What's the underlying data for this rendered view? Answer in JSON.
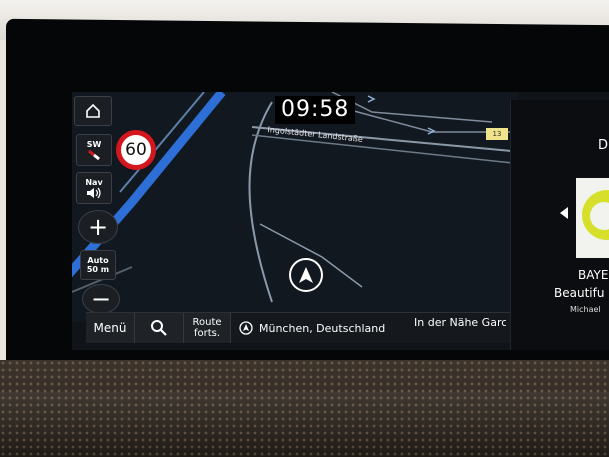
{
  "map": {
    "clock": "09:58",
    "street_label": "Ingolstädter Landstraße",
    "route_badge": "13",
    "speed_limit": "60"
  },
  "controls": {
    "compass_label": "SW",
    "nav_voice_label": "Nav",
    "zoom_mode_line1": "Auto",
    "zoom_mode_line2": "50 m",
    "zoom_in": "+",
    "zoom_out": "−"
  },
  "bottom_bar": {
    "menu_label": "Menü",
    "route_resume_line1": "Route",
    "route_resume_line2": "forts.",
    "destination": "München, Deutschland",
    "nearby": "In der Nähe Garc"
  },
  "media": {
    "letter_top": "D",
    "station_short": "BAYE",
    "track_title": "Beautifu",
    "artist": "Michael"
  },
  "colors": {
    "route_blue": "#2d6fd6",
    "road_gray": "#8a98a8",
    "speed_red": "#d4161e"
  }
}
